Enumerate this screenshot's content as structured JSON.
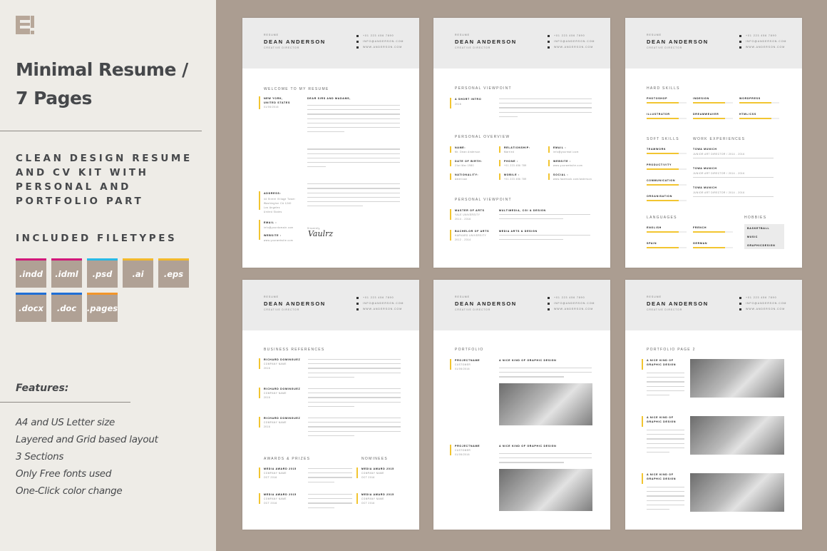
{
  "sidebar": {
    "logo_icon": "brand-logo-e-icon",
    "title_line1": "Minimal Resume /",
    "title_line2": "7 Pages",
    "subtitle": "CLEAN DESIGN RESUME AND CV KIT WITH PERSONAL AND PORTFOLIO PART",
    "filetypes_heading": "INCLUDED FILETYPES",
    "filetypes": [
      {
        "label": ".indd",
        "color": "#d2187a"
      },
      {
        "label": ".idml",
        "color": "#d2187a"
      },
      {
        "label": ".psd",
        "color": "#29b9e6"
      },
      {
        "label": ".ai",
        "color": "#f2b92c"
      },
      {
        "label": ".eps",
        "color": "#f2b92c"
      },
      {
        "label": ".docx",
        "color": "#1f6fd6"
      },
      {
        "label": ".doc",
        "color": "#1f6fd6"
      },
      {
        "label": ".pages",
        "color": "#f2962a"
      }
    ],
    "features_heading": "Features:",
    "features": [
      "A4 and US Letter size",
      "Layered and Grid based layout",
      "3 Sections",
      "Only Free fonts used",
      "One-Click color change"
    ]
  },
  "header": {
    "role_label": "RESUME",
    "name": "DEAN ANDERSON",
    "job_title": "CREATIVE DIRECTOR",
    "phone": "+01 223 456 7890",
    "email": "INFO@ANDERSON.COM",
    "website": "WWW.ANDERSON.COM"
  },
  "page1": {
    "heading": "WELCOME TO MY RESUME",
    "location_line1": "NEW YORK,",
    "location_line2": "UNITED STATES",
    "date": "01/05/2016",
    "greeting": "DEAR SIRS AND MADAMS,",
    "address_label": "ADDRESS:",
    "address_lines": [
      "44 Street Village Tower",
      "Washington CA 1240",
      "Los Angeles",
      "United States"
    ],
    "email_label": "EMAIL :",
    "email_value": "info@yourdomain.com",
    "website_label": "WEBSITE :",
    "website_value": "www.yourwebsite.com",
    "sincerely": "Sincerely,",
    "signature": "Vaulrz"
  },
  "page2": {
    "heading1": "PERSONAL VIEWPOINT",
    "intro_label": "A SHORT INTRO",
    "intro_year": "2016",
    "heading2": "PERSONAL OVERVIEW",
    "overview": [
      {
        "label": "NAME:",
        "value": "Mr. Dean Anderson"
      },
      {
        "label": "RELATIONSHIP:",
        "value": "Married"
      },
      {
        "label": "EMAIL :",
        "value": "info@yourmail.com"
      },
      {
        "label": "DATE OF BIRTH:",
        "value": "21st Mar 1980"
      },
      {
        "label": "PHONE :",
        "value": "+01 223 456 789"
      },
      {
        "label": "WEBSITE :",
        "value": "www.yourwebsite.com"
      },
      {
        "label": "NATIONALITY:",
        "value": "American"
      },
      {
        "label": "MOBILE :",
        "value": "+01 223 456 789"
      },
      {
        "label": "SOCIAL :",
        "value": "www.facebook.com/anderson"
      }
    ],
    "heading3": "PERSONAL VIEWPOINT",
    "education": [
      {
        "degree": "MASTER OF ARTS",
        "school": "YALE UNIVERSITY",
        "years": "2014 - 2016",
        "title": "MULTIMEDIA, CGI & DESIGN"
      },
      {
        "degree": "BACHELOR OF ARTS",
        "school": "HARVARD UNIVERSITY",
        "years": "2012 - 2014",
        "title": "MEDIA ARTS & DESIGN"
      }
    ]
  },
  "page3": {
    "hard_heading": "HARD SKILLS",
    "hard_skills": [
      {
        "label": "PHOTOSHOP",
        "level": 0.8
      },
      {
        "label": "INDESIGN",
        "level": 0.8
      },
      {
        "label": "WORDPRESS",
        "level": 0.8
      },
      {
        "label": "ILLUSTRATOR",
        "level": 0.8
      },
      {
        "label": "DREAMWEAVER",
        "level": 0.8
      },
      {
        "label": "HTML/CSS",
        "level": 0.8
      }
    ],
    "soft_heading": "SOFT SKILLS",
    "soft_skills": [
      {
        "label": "TEAMWORK",
        "level": 0.8
      },
      {
        "label": "PRODUCTIVITY",
        "level": 0.8
      },
      {
        "label": "COMMUNICATION",
        "level": 0.8
      },
      {
        "label": "ORGANISATION",
        "level": 0.8
      }
    ],
    "work_heading": "WORK EXPERIENCES",
    "work": [
      {
        "company": "TOWA MUNICH",
        "role": "JUNIOR ART DIRECTOR  /  2014 - 2016"
      },
      {
        "company": "TOWA MUNICH",
        "role": "JUNIOR ART DIRECTOR  /  2014 - 2016"
      },
      {
        "company": "TOWA MUNICH",
        "role": "JUNIOR ART DIRECTOR  /  2014 - 2016"
      }
    ],
    "lang_heading": "LANGUAGES",
    "languages": [
      {
        "label": "ENGLISH",
        "level": 0.8
      },
      {
        "label": "FRENCH",
        "level": 0.8
      },
      {
        "label": "SPAIN",
        "level": 0.8
      },
      {
        "label": "GERMAN",
        "level": 0.8
      }
    ],
    "hobbies_heading": "HOBBIES",
    "hobbies": [
      "BASKETBALL",
      "MUSIC",
      "GRAPHICDESIGN"
    ]
  },
  "page4": {
    "heading": "BUSINESS REFERENCES",
    "references": [
      {
        "name": "RICHARD DOMINGUEZ",
        "company": "COMPANY NAME",
        "year": "2016"
      },
      {
        "name": "RICHARD DOMINGUEZ",
        "company": "COMPANY NAME",
        "year": "2016"
      },
      {
        "name": "RICHARD DOMINGUEZ",
        "company": "COMPANY NAME",
        "year": "2016"
      }
    ],
    "awards_heading": "AWARDS & PRIZES",
    "nominees_heading": "NOMINEES",
    "awards": [
      {
        "title": "MEDIA AWARD 2015",
        "company": "COMPANY NAME",
        "date": "OCT 2016"
      },
      {
        "title": "MEDIA AWARD 2015",
        "company": "COMPANY NAME",
        "date": "OCT 2016"
      }
    ],
    "nominees": [
      {
        "title": "MEDIA AWARD 2015",
        "company": "COMPANY NAME",
        "date": "OCT 2016"
      },
      {
        "title": "MEDIA AWARD 2015",
        "company": "COMPANY NAME",
        "date": "OCT 2016"
      }
    ]
  },
  "page5": {
    "heading": "PORTFOLIO",
    "projects": [
      {
        "name": "PROJECTNAME",
        "customer": "CUSTOMER",
        "date": "01/05/2016",
        "title": "A NICE KIND OF GRAPHIC DESIGN"
      },
      {
        "name": "PROJECTNAME",
        "customer": "CUSTOMER",
        "date": "01/05/2016",
        "title": "A NICE KIND OF GRAPHIC DESIGN"
      }
    ]
  },
  "page6": {
    "heading": "PORTFOLIO PAGE 2",
    "items": [
      {
        "title1": "A NICE KIND OF",
        "title2": "GRAPHIC DESIGN"
      },
      {
        "title1": "A NICE KIND OF",
        "title2": "GRAPHIC DESIGN"
      },
      {
        "title1": "A NICE KIND OF",
        "title2": "GRAPHIC DESIGN"
      }
    ]
  },
  "colors": {
    "accent": "#f2c531",
    "background": "#ab9d91",
    "sidebar": "#eeece7",
    "text_dark": "#46484b"
  }
}
